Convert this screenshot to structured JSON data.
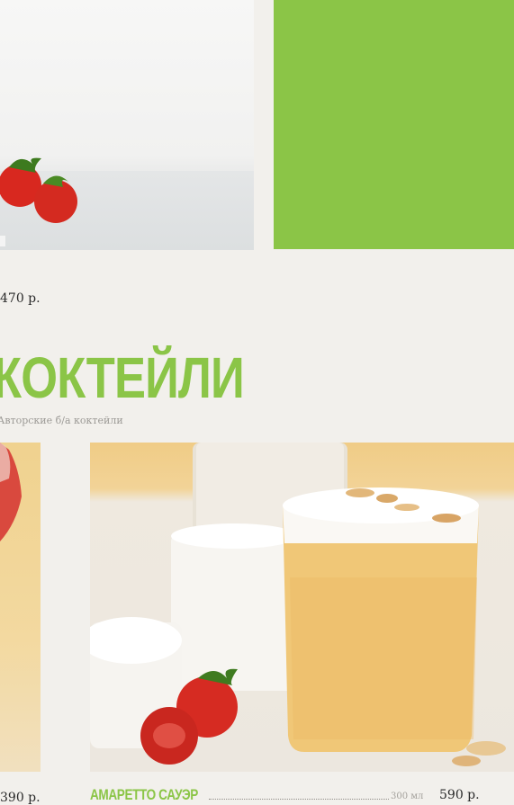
{
  "top_row": {
    "prev_item_price": "470 р."
  },
  "section": {
    "title": "КОКТЕЙЛИ",
    "subtitle": "Авторские б/а коктейли"
  },
  "cards": [
    {
      "price": "390 р."
    },
    {
      "name": "АМАРЕТТО САУЭР",
      "volume": "300 мл",
      "price": "590 р."
    }
  ],
  "colors": {
    "accent": "#8bc547",
    "background": "#f2f0ec"
  }
}
